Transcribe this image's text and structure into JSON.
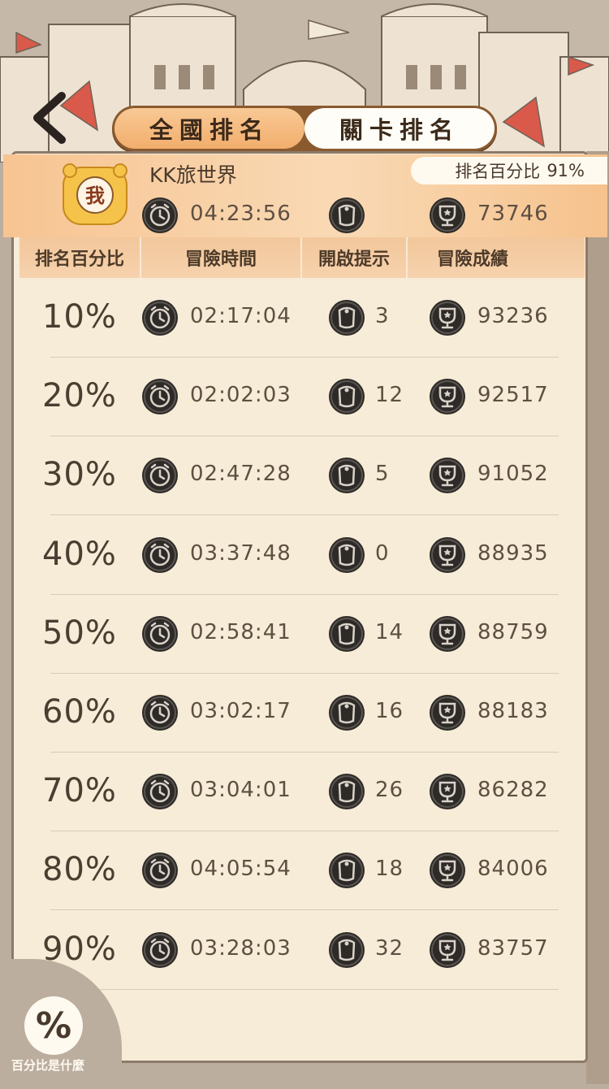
{
  "tabs": {
    "national": "全國排名",
    "level": "關卡排名"
  },
  "me": {
    "avatar_char": "我",
    "name": "KK旅世界",
    "percentile_label": "排名百分比",
    "percentile_value": "91%",
    "time": "04:23:56",
    "hints": "",
    "score": "73746"
  },
  "headers": {
    "percentile": "排名百分比",
    "time": "冒險時間",
    "hints": "開啟提示",
    "score": "冒險成績"
  },
  "rows": [
    {
      "pct": "10%",
      "time": "02:17:04",
      "hints": "3",
      "score": "93236"
    },
    {
      "pct": "20%",
      "time": "02:02:03",
      "hints": "12",
      "score": "92517"
    },
    {
      "pct": "30%",
      "time": "02:47:28",
      "hints": "5",
      "score": "91052"
    },
    {
      "pct": "40%",
      "time": "03:37:48",
      "hints": "0",
      "score": "88935"
    },
    {
      "pct": "50%",
      "time": "02:58:41",
      "hints": "14",
      "score": "88759"
    },
    {
      "pct": "60%",
      "time": "03:02:17",
      "hints": "16",
      "score": "88183"
    },
    {
      "pct": "70%",
      "time": "03:04:01",
      "hints": "26",
      "score": "86282"
    },
    {
      "pct": "80%",
      "time": "04:05:54",
      "hints": "18",
      "score": "84006"
    },
    {
      "pct": "90%",
      "time": "03:28:03",
      "hints": "32",
      "score": "83757"
    }
  ],
  "help": {
    "symbol": "%",
    "label": "百分比是什麼"
  },
  "icons": {
    "time": "clock-icon",
    "hints": "hint-coin-icon",
    "score": "trophy-icon",
    "back": "back-arrow-icon"
  },
  "colors": {
    "accent": "#f2ae6d",
    "panel": "#f7ecd7",
    "icon_dark": "#2d2a28"
  }
}
